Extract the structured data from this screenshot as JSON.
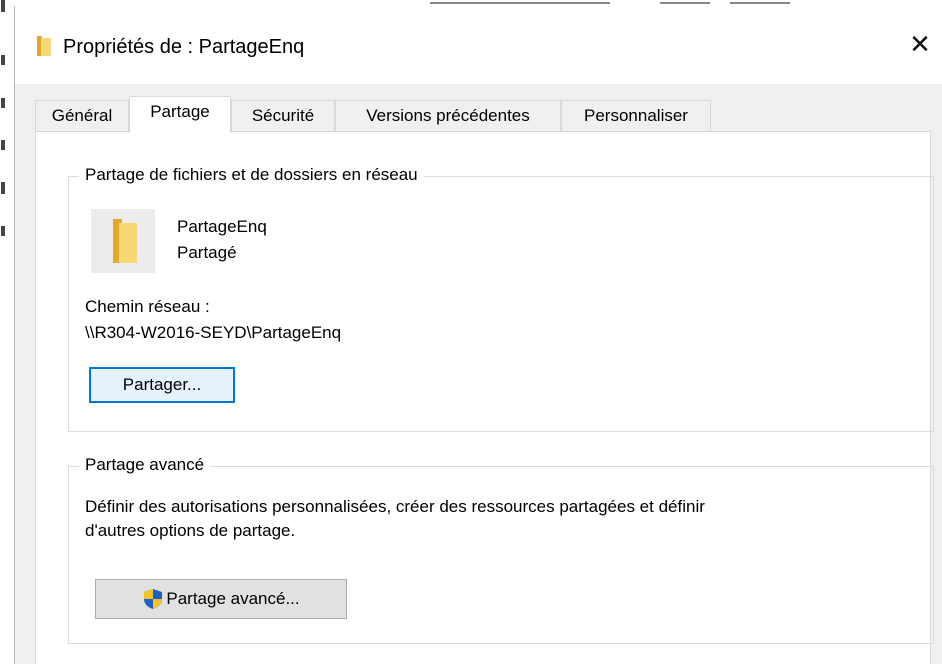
{
  "window": {
    "title": "Propriétés de : PartageEnq",
    "close_glyph": "✕"
  },
  "tabs": [
    {
      "label": "Général",
      "active": false
    },
    {
      "label": "Partage",
      "active": true
    },
    {
      "label": "Sécurité",
      "active": false
    },
    {
      "label": "Versions précédentes",
      "active": false
    },
    {
      "label": "Personnaliser",
      "active": false
    }
  ],
  "network_sharing": {
    "legend": "Partage de fichiers et de dossiers en réseau",
    "folder_name": "PartageEnq",
    "status": "Partagé",
    "path_label": "Chemin réseau :",
    "path_value": "\\\\R304-W2016-SEYD\\PartageEnq",
    "share_button": "Partager..."
  },
  "advanced_sharing": {
    "legend": "Partage avancé",
    "description_line1": "Définir des autorisations personnalisées, créer des ressources partagées et définir",
    "description_line2": "d'autres options de partage.",
    "button_label": "Partage avancé..."
  },
  "icons": {
    "title_icon": "folder-icon",
    "folder_icon": "folder-icon",
    "shield_icon": "uac-shield-icon"
  },
  "colors": {
    "accent": "#0078d7",
    "folder_yellow": "#f8d775",
    "folder_dark": "#e0a82e"
  }
}
